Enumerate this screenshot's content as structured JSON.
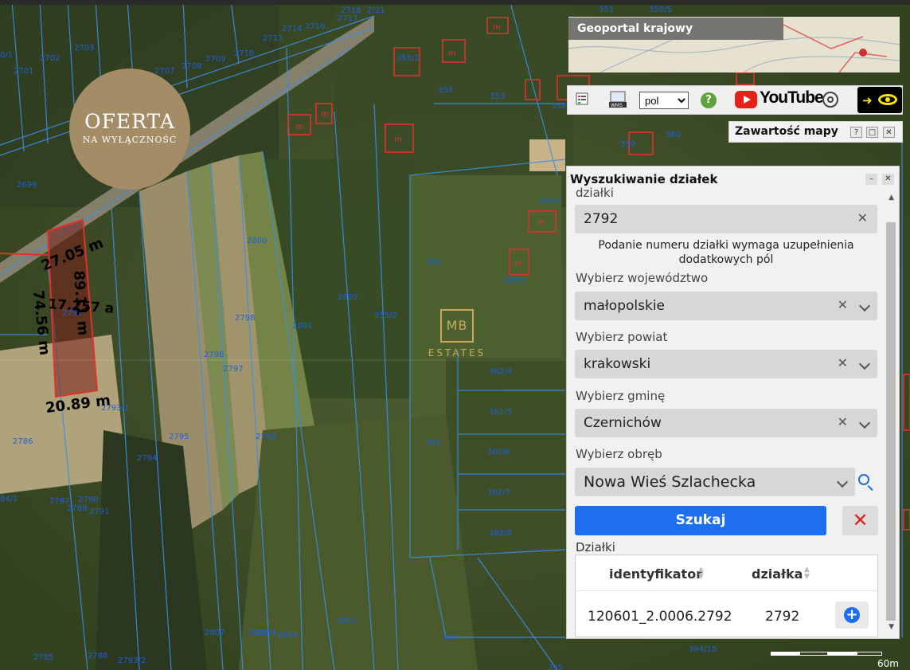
{
  "badge": {
    "line1": "OFERTA",
    "line2": "NA WYŁĄCZNOŚĆ"
  },
  "logo": {
    "mark": "MB",
    "sub": "ESTATES"
  },
  "geoportal": {
    "title": "Geoportal krajowy"
  },
  "toolbar": {
    "language_value": "pol",
    "language_options": [
      "pol"
    ],
    "youtube_label": "YouTube",
    "help_label": "?",
    "icons": [
      "legend-icon",
      "wms-icon",
      "help-icon",
      "youtube-icon",
      "accessibility-icon",
      "contrast-eye-icon"
    ]
  },
  "map_content": {
    "title": "Zawartość mapy",
    "help": "?",
    "close": "✕"
  },
  "panel": {
    "title": "Wyszukiwanie działek",
    "section_label": "działki",
    "parcel_number": "2792",
    "info": "Podanie numeru działki wymaga uzupełnienia dodatkowych pól",
    "voivodeship": {
      "label": "Wybierz województwo",
      "value": "małopolskie"
    },
    "county": {
      "label": "Wybierz powiat",
      "value": "krakowski"
    },
    "commune": {
      "label": "Wybierz gminę",
      "value": "Czernichów"
    },
    "precinct": {
      "label": "Wybierz obręb",
      "value": "Nowa Wieś Szlachecka"
    },
    "search_button": "Szukaj",
    "clear_button": "✕",
    "results_label": "Działki",
    "table": {
      "headers": [
        "identyfikator",
        "działka"
      ],
      "rows": [
        {
          "id": "120601_2.0006.2792",
          "parcel": "2792"
        }
      ]
    }
  },
  "map": {
    "highlight_color": "#e0312b",
    "parcel_line_color": "#3a8fe8",
    "dimension_labels": [
      "27.05 m",
      "74.56 m",
      "89.11 m",
      "20.89 m",
      "17.257 a"
    ],
    "parcel_labels": [
      "2718",
      "2/21",
      "351",
      "350/5",
      "2701",
      "2702",
      "2703",
      "2707",
      "2708",
      "2709",
      "2710",
      "2713",
      "2714",
      "2716",
      "2717",
      "355/1",
      "354",
      "353",
      "358",
      "360",
      "359",
      "358/2",
      "2699",
      "2800",
      "2798",
      "2801",
      "2802",
      "356",
      "357/1",
      "355/2",
      "2796",
      "2797",
      "2793/1",
      "2786",
      "2795",
      "2799",
      "2794",
      "362/4",
      "362/5",
      "363",
      "362/6",
      "362/7",
      "362/8",
      "2787",
      "2789",
      "2790",
      "2791",
      "84/1",
      "2807",
      "2805",
      "2804",
      "2803",
      "364",
      "2785",
      "2788",
      "2793/2",
      "394/15",
      "395",
      "349/2",
      "2798"
    ],
    "scale_label": "60m"
  }
}
